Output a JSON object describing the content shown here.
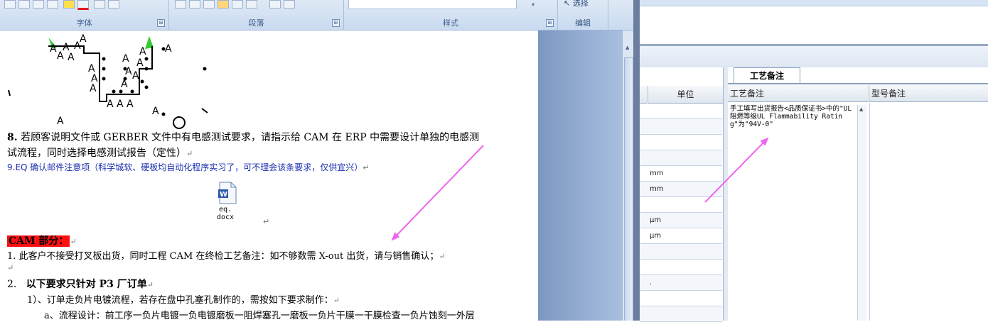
{
  "word": {
    "ribbon": {
      "groups": [
        {
          "label": "字体"
        },
        {
          "label": "段落"
        },
        {
          "label": "样式"
        },
        {
          "label": "编辑"
        }
      ],
      "edit_select_label": "选择",
      "launcher_glyph": "⊞"
    },
    "doc": {
      "item8_num": "8.",
      "item8_line1": " 若顾客说明文件或 GERBER 文件中有电感测试要求，请指示给 CAM 在 ERP 中需要设计单独的电感测",
      "item8_line2": "试流程，同时选择电感测试报告（定性）",
      "item9": "9.EQ 确认邮件注意项（科学城软、硬板均自动化程序实习了，可不理会该条要求，仅供宜兴）",
      "attachment_name": "eq. docx",
      "cam_heading": "CAM 部分：",
      "cam_item1": "1.   此客户不接受打叉板出货，同时工程 CAM 在终检工艺备注：如不够数需 X-out 出货，请与销售确认；",
      "cam_item2_num": "2.",
      "cam_item2": "以下要求只针对 P3 厂订单",
      "cam_sub1": "1）、订单走负片电镀流程，若存在盘中孔塞孔制作的，需按如下要求制作：",
      "cam_sub_a": "a、流程设计：前工序一负片电镀一负电镀磨板一阻焊塞孔一磨板一负片干膜一干膜检查一负片蚀刻一外层",
      "para_mark": "↵"
    }
  },
  "erp": {
    "grid": {
      "col_unit": "单位",
      "rows": [
        "",
        "",
        "",
        "",
        "mm",
        "mm",
        "",
        "μm",
        "μm",
        "",
        "",
        ".",
        "",
        ""
      ]
    },
    "memo_tab": "工艺备注",
    "columns": {
      "process_memo": "工艺备注",
      "model_memo": "型号备注"
    },
    "process_memo_text": "手工填写出货报告<品质保证书>中的\"UL阻燃等级UL Flammability Rating\"为\"94V-0\""
  },
  "colors": {
    "ribbon_bg": "#d3e1f3",
    "red_highlight": "#ff1010",
    "link_blue": "#1b2fb0",
    "arrow_pink": "#ee66ee"
  }
}
